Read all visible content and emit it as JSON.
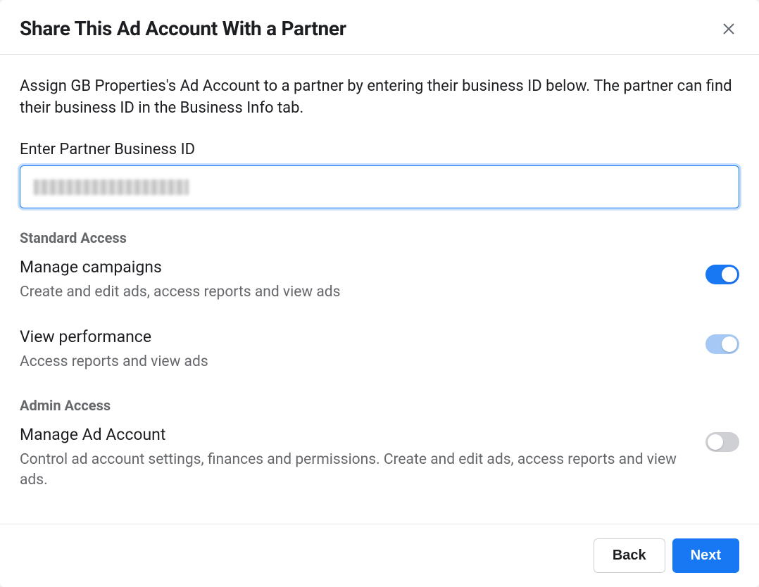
{
  "header": {
    "title": "Share This Ad Account With a Partner"
  },
  "body": {
    "description": "Assign GB Properties's Ad Account to a partner by entering their business ID below. The partner can find their business ID in the Business Info tab.",
    "input_label": "Enter Partner Business ID",
    "input_value": ""
  },
  "sections": {
    "standard": {
      "heading": "Standard Access",
      "items": [
        {
          "title": "Manage campaigns",
          "desc": "Create and edit ads, access reports and view ads",
          "checked": true,
          "toneLight": false
        },
        {
          "title": "View performance",
          "desc": "Access reports and view ads",
          "checked": true,
          "toneLight": true
        }
      ]
    },
    "admin": {
      "heading": "Admin Access",
      "items": [
        {
          "title": "Manage Ad Account",
          "desc": "Control ad account settings, finances and permissions. Create and edit ads, access reports and view ads.",
          "checked": false,
          "toneLight": false
        }
      ]
    }
  },
  "footer": {
    "back": "Back",
    "next": "Next"
  }
}
